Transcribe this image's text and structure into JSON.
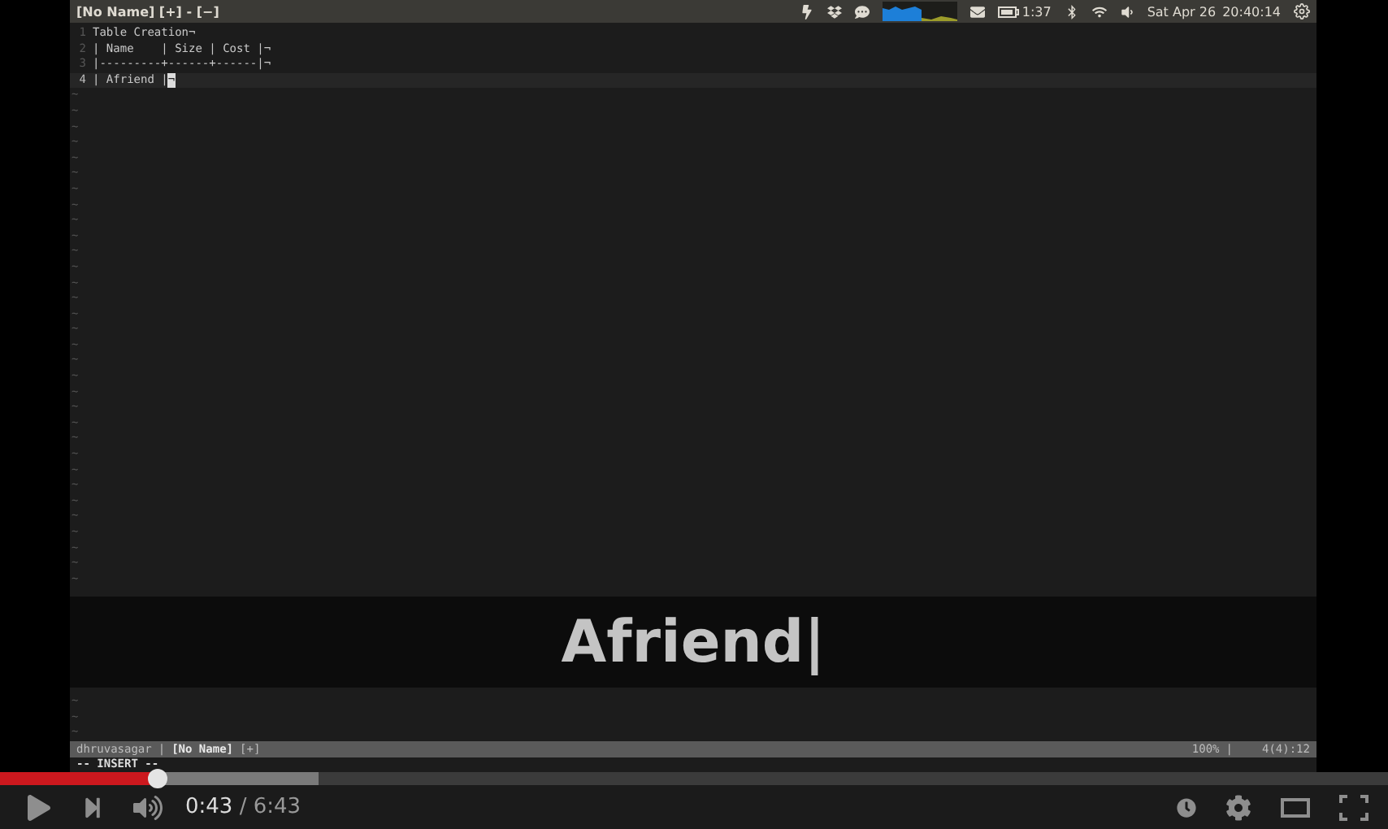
{
  "panel": {
    "window_title": "[No Name] [+] - [−]",
    "battery_time": "1:37",
    "date": "Sat Apr 26",
    "time": "20:40:14"
  },
  "editor": {
    "lines": [
      {
        "number": "1",
        "text": "Table Creation¬",
        "current": false
      },
      {
        "number": "2",
        "text": "| Name    | Size | Cost |¬",
        "current": false
      },
      {
        "number": "3",
        "text": "|---------+------+------|¬",
        "current": false
      },
      {
        "number": "4",
        "text": "| Afriend |",
        "cursor": "¬",
        "current": true
      }
    ],
    "filler_above": [
      "~",
      "~",
      "~",
      "~",
      "~",
      "~",
      "~",
      "~",
      "~",
      "~",
      "~",
      "~",
      "~",
      "~",
      "~",
      "~",
      "~",
      "~",
      "~",
      "~",
      "~",
      "~",
      "~",
      "~",
      "~",
      "~",
      "~",
      "~",
      "~",
      "~",
      "~",
      "~"
    ],
    "filler_below": [
      "~",
      "~",
      "~"
    ]
  },
  "caption": "Afriend|",
  "status_line": {
    "user": "dhruvasagar",
    "separator": "|",
    "file": "[No Name]",
    "modified": "[+]",
    "percent": "100%",
    "separator_2": "|",
    "position": "4(4):12"
  },
  "mode": "-- INSERT --",
  "player": {
    "progress": {
      "level": 0.114
    },
    "buffer": {
      "level": 0.23
    },
    "current_time": "0:43",
    "duration": "/ 6:43",
    "playing": false
  }
}
